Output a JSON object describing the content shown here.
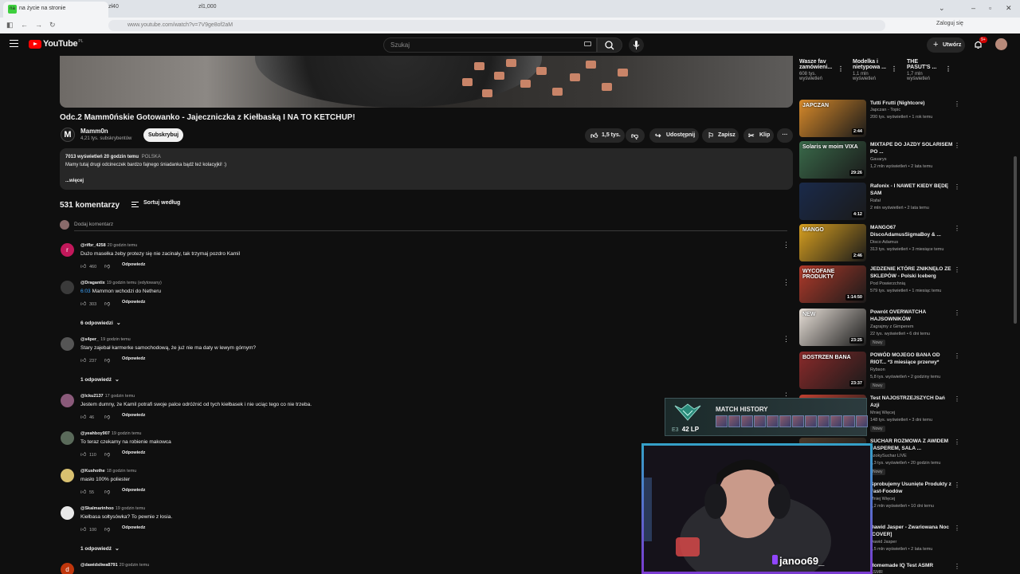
{
  "browser": {
    "tab_title": "na życie na stronie",
    "tab_favicon_text": "na",
    "tab2": "zł40",
    "tab3": "zł1,000",
    "url": "www.youtube.com/watch?v=7V9ge8of2aM",
    "login": "Zaloguj się"
  },
  "header": {
    "logo": "YouTube",
    "logo_suffix": "PL",
    "search_placeholder": "Szukaj",
    "create": "Utwórz",
    "notif_badge": "9+"
  },
  "video": {
    "title": "Odc.2 Mamm0ńskie Gotowanko - Jajeczniczka z Kiełbaską I NA TO KETCHUP!",
    "channel_initial": "M",
    "channel": "Mamm0n",
    "subs": "4,21 tys. subskrybentów",
    "subscribe": "Subskrybuj",
    "likes": "1,5 tys.",
    "share": "Udostępnij",
    "save": "Zapisz",
    "clip": "Klip",
    "desc_meta": "7013 wyświetleń  20 godzin temu",
    "desc_country": "POLSKA",
    "desc_text": "Mamy tutaj drugi odcineczek bardzo fajnego śniadanka bądź też kolacyjki! :)",
    "desc_more": "...więcej"
  },
  "comments": {
    "count": "531 komentarzy",
    "sort": "Sortuj według",
    "add": "Dodaj komentarz",
    "reply": "Odpowiedz",
    "items": [
      {
        "initial": "r",
        "color": "#c2185b",
        "author": "@rifbr_4258",
        "time": "20 godzin temu",
        "ts": "",
        "text": "Dużo masełka żeby protezy się nie zacinały, tak trzymaj pozdro Kamil",
        "likes": "460"
      },
      {
        "initial": "",
        "color": "#3a3a3a",
        "author": "@Dragantix",
        "time": "19 godzin temu (edytowany)",
        "ts": "6:03",
        "text": "Mammon wchodzi do Netheru",
        "likes": "303"
      },
      {
        "initial": "",
        "color": "#555555",
        "author": "@s4per_",
        "time": "19 godzin temu",
        "ts": "",
        "text": "Stary zajebał karmerke samochodową, że już nie ma daty w lewym górnym?",
        "likes": "237"
      },
      {
        "initial": "",
        "color": "#8a5a7a",
        "author": "@lcku2137",
        "time": "17 godzin temu",
        "ts": "",
        "text": "Jestem dumny, że Kamil potrafi swoje palce odróżnić od tych kiełbasek i nie uciąc tego co nie trzeba.",
        "likes": "46"
      },
      {
        "initial": "",
        "color": "#5a6a5a",
        "author": "@yeahboy907",
        "time": "19 godzin temu",
        "ts": "",
        "text": "To teraz czekamy na robienie makowca",
        "likes": "110"
      },
      {
        "initial": "",
        "color": "#d8c070",
        "author": "@Kushothe",
        "time": "18 godzin temu",
        "ts": "",
        "text": "masło 100% poliester",
        "likes": "55"
      },
      {
        "initial": "",
        "color": "#e8e8e8",
        "author": "@Skalmarinhoo",
        "time": "19 godzin temu",
        "ts": "",
        "text": "Kiełbasa sołtysówka? To pewnie z łosia.",
        "likes": "100"
      },
      {
        "initial": "d",
        "color": "#bf360c",
        "author": "@dawidsliwa8791",
        "time": "20 godzin temu",
        "ts": "",
        "text": "",
        "likes": ""
      }
    ],
    "replies": [
      "6 odpowiedzi",
      "1 odpowiedź",
      "1 odpowiedź"
    ]
  },
  "sidebar": {
    "shorts": [
      {
        "title": "Wasze fav zamówieni...",
        "views": "608 tys. wyświetleń"
      },
      {
        "title": "Modelka i nietypowa ...",
        "views": "1,1 mln wyświetleń"
      },
      {
        "title": "THE PASUT'S ...",
        "views": "1,7 mln wyświetleń"
      }
    ],
    "items": [
      {
        "title": "Tutti Frutti (Nightcore)",
        "channel": "Japczan - Topic",
        "meta": "200 tys. wyświetleń • 1 rok temu",
        "dur": "2:44",
        "thumb": "#d88a2a",
        "badge": "",
        "thumb_text": "JAPCZAN"
      },
      {
        "title": "MIXTAPE DO JAZDY SOLARISEM PO ...",
        "channel": "Gavarys",
        "meta": "1,2 mln wyświetleń • 2 lata temu",
        "dur": "29:26",
        "thumb": "#3a6a4a",
        "badge": "",
        "thumb_text": "Solaris w moim VIXA"
      },
      {
        "title": "Rafonix - I NAWET KIEDY BĘDĘ SAM",
        "channel": "Rafał",
        "meta": "2 mln wyświetleń • 2 lata temu",
        "dur": "4:12",
        "thumb": "#1a2a4a",
        "badge": "",
        "thumb_text": ""
      },
      {
        "title": "MANGO67 DiscoAdamusSigmaBoy  & ...",
        "channel": "Disco Adamus",
        "meta": "313 tys. wyświetleń • 3 miesiące temu",
        "dur": "2:46",
        "thumb": "#d8a020",
        "badge": "",
        "thumb_text": "MANGO"
      },
      {
        "title": "JEDZENIE KTÓRE ZNIKNĘŁO ZE SKLEPÓW - Polski Iceberg",
        "channel": "Pod Powierzchnią",
        "meta": "579 tys. wyświetleń • 1 miesiąc temu",
        "dur": "1:14:50",
        "thumb": "#b03a2a",
        "badge": "",
        "thumb_text": "WYCOFANE PRODUKTY"
      },
      {
        "title": "Powrót OVERWATCHA HAJSOWNIKÓW",
        "channel": "Zagrajmy z Gimperem",
        "meta": "22 tys. wyświetleń • 6 dni temu",
        "dur": "23:25",
        "thumb": "#e8e0d8",
        "badge": "Nowy",
        "thumb_text": "NEW"
      },
      {
        "title": "POWÓD MOJEGO BANA OD RIOT... *3 miesiące przerwy*",
        "channel": "Rybson",
        "meta": "5,8 tys. wyświetleń • 2 godziny temu",
        "dur": "23:37",
        "thumb": "#8a2a2a",
        "badge": "Nowy",
        "thumb_text": "BOSTRZEN BANA"
      },
      {
        "title": "Test NAJOSTRZEJSZYCH Dań Azji",
        "channel": "Mniej Więcej",
        "meta": "148 tys. wyświetleń • 3 dni temu",
        "dur": "",
        "thumb": "#c04030",
        "badge": "Nowy",
        "thumb_text": ""
      },
      {
        "title": "SUCHAR ROZMOWA Z AWIDEM JASPEREM, SALA ...",
        "channel": "SzokySuchar LIVE",
        "meta": "1,3 tys. wyświetleń • 20 godzin temu",
        "dur": "",
        "thumb": "#4a3a2a",
        "badge": "Nowy",
        "thumb_text": ""
      },
      {
        "title": "Sprobujemy Usunięte Produkty z Fast-Foodów",
        "channel": "Mniej Więcej",
        "meta": "1,2 mln wyświetleń • 10 dni temu",
        "dur": "",
        "thumb": "#3a5a3a",
        "badge": "",
        "thumb_text": ""
      },
      {
        "title": "Dawid Jasper - Zwariowana Noc [COVER]",
        "channel": "Dawid Jasper",
        "meta": "1,5 mln wyświetleń • 2 lata temu",
        "dur": "",
        "thumb": "#2a2a3a",
        "badge": "",
        "thumb_text": ""
      },
      {
        "title": "Homemade IQ Test ASMR",
        "channel": "ASMR",
        "meta": "",
        "dur": "",
        "thumb": "#5a4a3a",
        "badge": "",
        "thumb_text": ""
      }
    ]
  },
  "overlay": {
    "match_title": "MATCH HISTORY",
    "rank": "E3",
    "lp": "42 LP",
    "cam_name": "janoo69_"
  },
  "colors": {
    "background": "#0f0f0f",
    "accent_red": "#ff0000",
    "link_blue": "#3ea6ff",
    "twitch_purple": "#9146ff"
  }
}
